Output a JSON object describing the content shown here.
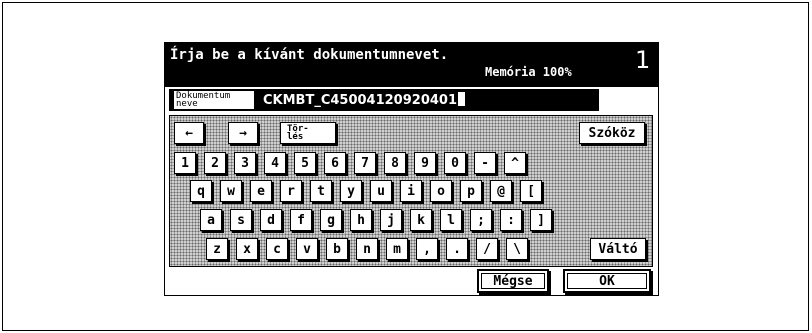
{
  "header": {
    "instruction": "Írja be a kívánt dokumentumnevet.",
    "memory": "Memória 100%",
    "page_number": "1"
  },
  "document": {
    "label_line1": "Dokumentum",
    "label_line2": "neve",
    "value": "CKMBT_C45004120920401"
  },
  "keyboard": {
    "left_arrow": "←",
    "right_arrow": "→",
    "delete_line1": "Tör-",
    "delete_line2": "lés",
    "space": "Szóköz",
    "row1": [
      "1",
      "2",
      "3",
      "4",
      "5",
      "6",
      "7",
      "8",
      "9",
      "0",
      "-",
      "^"
    ],
    "row2": [
      "q",
      "w",
      "e",
      "r",
      "t",
      "y",
      "u",
      "i",
      "o",
      "p",
      "@",
      "["
    ],
    "row3": [
      "a",
      "s",
      "d",
      "f",
      "g",
      "h",
      "j",
      "k",
      "l",
      ";",
      ":",
      "]"
    ],
    "row4": [
      "z",
      "x",
      "c",
      "v",
      "b",
      "n",
      "m",
      ",",
      ".",
      "/",
      "\\"
    ],
    "shift": "Váltó"
  },
  "actions": {
    "cancel": "Mégse",
    "ok": "OK"
  }
}
